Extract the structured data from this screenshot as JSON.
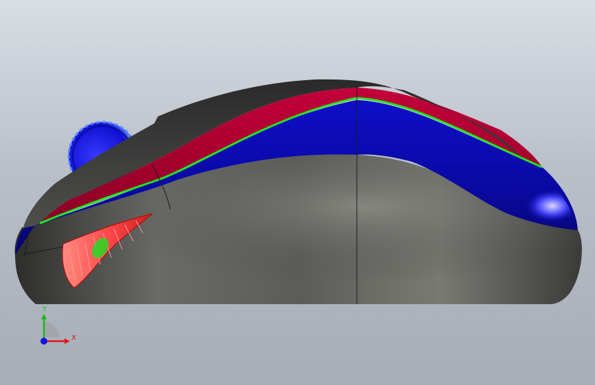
{
  "scene": {
    "model_parts": [
      {
        "name": "shell-top",
        "color": "#3b3b3b"
      },
      {
        "name": "shell-body",
        "color": "#4a4a48"
      },
      {
        "name": "accent-band-red",
        "color": "#a8002e"
      },
      {
        "name": "accent-band-blue",
        "color": "#0c0db4"
      },
      {
        "name": "parting-line",
        "color": "#22e622"
      },
      {
        "name": "scroll-wheel",
        "color": "#1f1fe0"
      },
      {
        "name": "side-grip",
        "color": "#ff5a5a"
      }
    ],
    "background": {
      "top": "#d9dde4",
      "bottom": "#a7adb7"
    }
  },
  "triad": {
    "x_label": "X",
    "y_label": "Y",
    "colors": {
      "x": "#e01414",
      "y": "#14b814",
      "z": "#1414e0"
    }
  }
}
